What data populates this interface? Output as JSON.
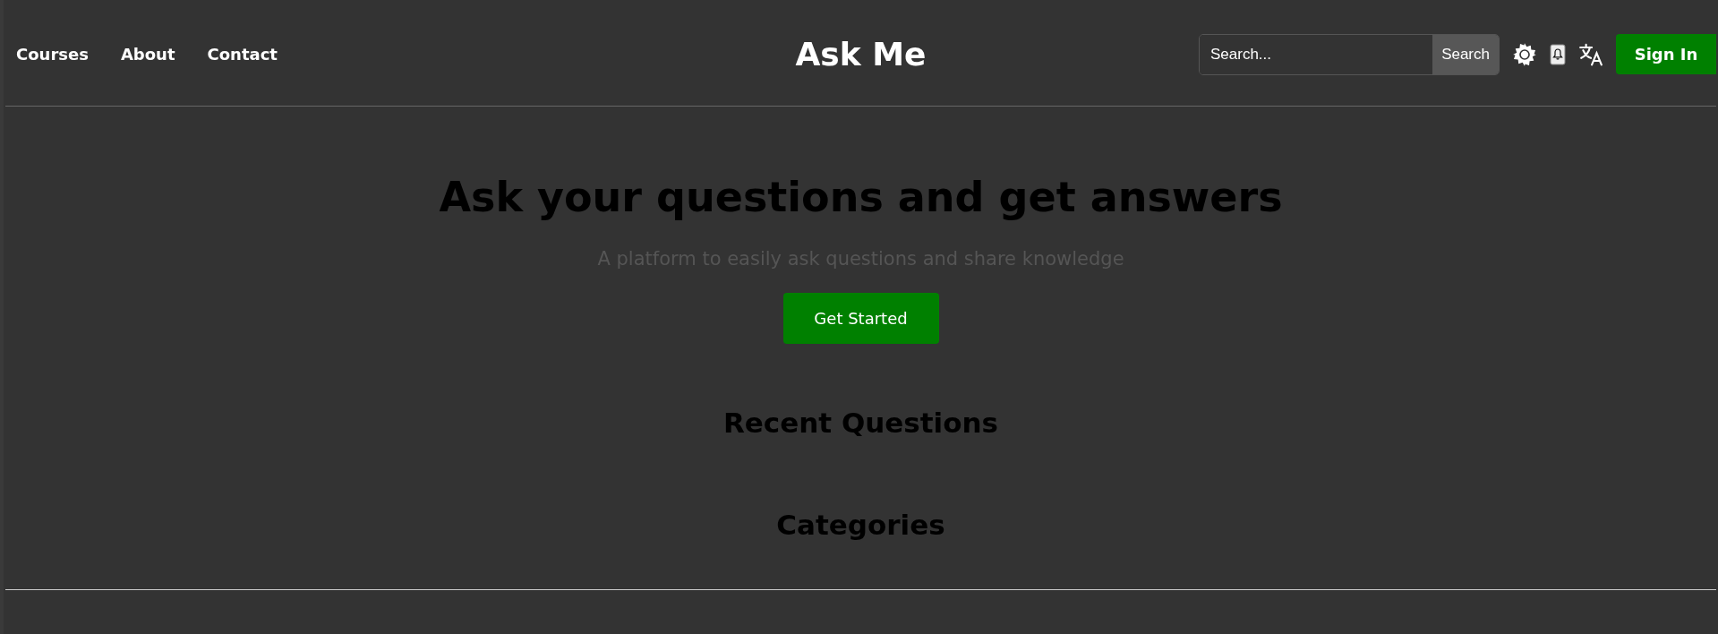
{
  "nav": {
    "links": [
      "Courses",
      "About",
      "Contact"
    ]
  },
  "brand": "Ask Me",
  "search": {
    "placeholder": "Search...",
    "button": "Search"
  },
  "sign_in": "Sign In",
  "hero": {
    "title": "Ask your questions and get answers",
    "subtitle": "A platform to easily ask questions and share knowledge",
    "button": "Get Started"
  },
  "sections": [
    "Recent Questions",
    "Categories"
  ]
}
